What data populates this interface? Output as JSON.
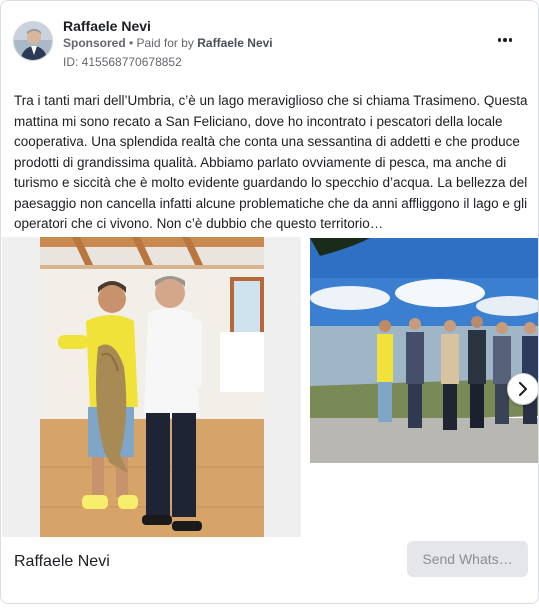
{
  "post": {
    "author": "Raffaele Nevi",
    "sponsored_label": "Sponsored",
    "separator": " • ",
    "paid_for_prefix": "Paid for by ",
    "paid_for_name": "Raffaele Nevi",
    "ad_id": "ID: 415568770678852",
    "more_icon": "more-horizontal-icon",
    "body": "Tra i tanti mari dell’Umbria, c’è un lago meraviglioso che si chiama Trasimeno. Questa mattina mi sono recato a San Feliciano, dove ho incontrato i pescatori della locale cooperativa. Una splendida realtà che conta una sessantina di addetti e che produce prodotti di grandissima qualità. Abbiamo parlato ovviamente di pesca, ma anche di turismo e siccità che è molto evidente guardando lo specchio d’acqua. La bellezza del paesaggio non cancella infatti alcune problematiche che da anni affliggono il lago e gli operatori che ci vivono. Non c’è dubbio che questo territorio…"
  },
  "carousel": {
    "next_icon": "chevron-right-icon"
  },
  "footer": {
    "page_name": "Raffaele Nevi",
    "cta_label": "Send Whats…"
  },
  "colors": {
    "text": "#1c1e21",
    "secondary": "#65676b",
    "cta_bg": "#e4e6eb",
    "cta_text": "#8a8d91",
    "border": "#dadde1"
  }
}
